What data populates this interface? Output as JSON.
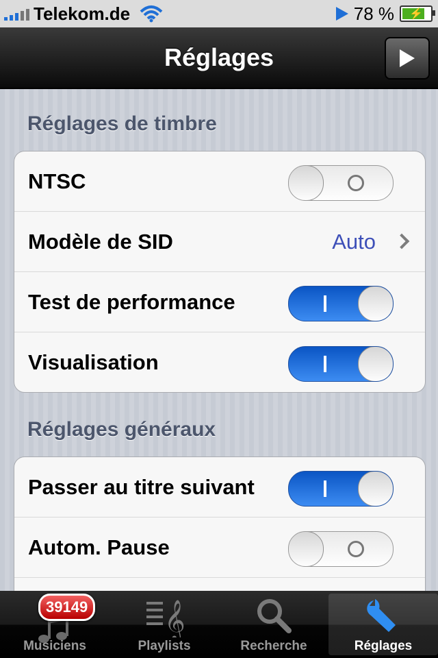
{
  "status_bar": {
    "carrier": "Telekom.de",
    "battery_percent": "78 %",
    "battery_level": 0.78
  },
  "navbar": {
    "title": "Réglages"
  },
  "sections": [
    {
      "title": "Réglages de timbre",
      "rows": [
        {
          "label": "NTSC",
          "type": "toggle",
          "on": false
        },
        {
          "label": "Modèle de SID",
          "type": "value",
          "value": "Auto"
        },
        {
          "label": "Test de performance",
          "type": "toggle",
          "on": true
        },
        {
          "label": "Visualisation",
          "type": "toggle",
          "on": true
        }
      ]
    },
    {
      "title": "Réglages généraux",
      "rows": [
        {
          "label": "Passer au titre suivant",
          "type": "toggle",
          "on": true
        },
        {
          "label": "Autom. Pause",
          "type": "toggle",
          "on": false
        }
      ]
    }
  ],
  "tabbar": {
    "tabs": [
      {
        "label": "Musiciens",
        "badge": "39149",
        "icon": "music-note-icon"
      },
      {
        "label": "Playlists",
        "icon": "playlist-icon"
      },
      {
        "label": "Recherche",
        "icon": "search-icon"
      },
      {
        "label": "Réglages",
        "icon": "wrench-icon",
        "active": true
      }
    ]
  },
  "colors": {
    "accent": "#1f6fd6",
    "value_text": "#3d4fb8",
    "badge": "#d01010"
  }
}
